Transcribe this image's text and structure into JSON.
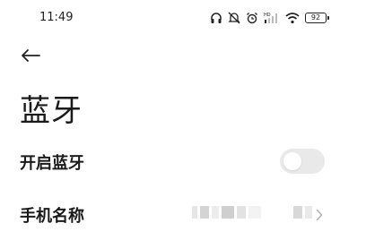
{
  "status_bar": {
    "time": "11:49",
    "battery_level": "92",
    "icons": [
      "headphones-icon",
      "mute-icon",
      "alarm-icon",
      "hd-signal-icon",
      "wifi-icon",
      "battery-icon"
    ]
  },
  "nav": {
    "back_icon": "arrow-left-icon"
  },
  "page": {
    "title": "蓝牙"
  },
  "settings": {
    "bluetooth": {
      "label": "开启蓝牙",
      "enabled": false
    },
    "device_name": {
      "label": "手机名称",
      "chevron_icon": "chevron-right-icon"
    }
  },
  "colors": {
    "toggle_off": "#e9e9e9",
    "text": "#1a1a1a"
  }
}
